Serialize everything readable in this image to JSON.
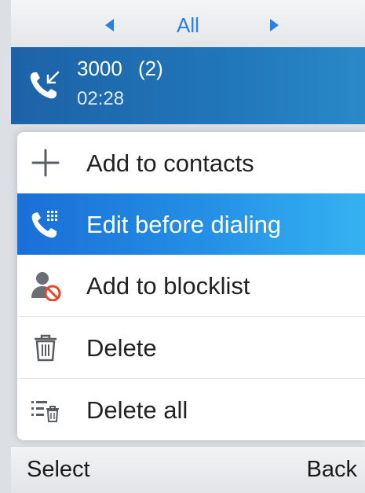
{
  "filter": {
    "label": "All"
  },
  "call_entry": {
    "number": "3000",
    "count": "(2)",
    "duration": "02:28",
    "icon": "incoming-call-icon"
  },
  "menu": {
    "items": [
      {
        "label": "Add to contacts",
        "icon": "plus-icon"
      },
      {
        "label": "Edit before dialing",
        "icon": "phone-dialpad-icon",
        "selected": true
      },
      {
        "label": "Add to blocklist",
        "icon": "block-contact-icon"
      },
      {
        "label": "Delete",
        "icon": "trash-icon"
      },
      {
        "label": "Delete all",
        "icon": "delete-all-icon"
      }
    ]
  },
  "softkeys": {
    "left": "Select",
    "right": "Back"
  },
  "colors": {
    "accent": "#2b7fe0",
    "selected_start": "#1a6fd6",
    "selected_end": "#35b2f2",
    "block_red": "#e8452c"
  }
}
